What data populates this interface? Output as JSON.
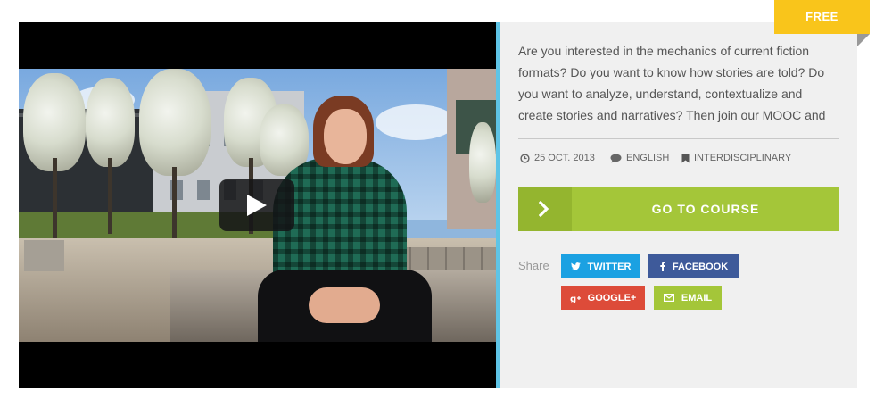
{
  "badge": {
    "label": "FREE"
  },
  "video": {
    "play_label": "Play video"
  },
  "course": {
    "description": "Are you interested in the mechanics of current fiction formats? Do you want to know how stories are told? Do you want to analyze, understand, contextualize and create stories and narratives? Then join our MOOC and",
    "meta": {
      "date": "25 OCT. 2013",
      "language": "ENGLISH",
      "category": "INTERDISCIPLINARY"
    },
    "cta_label": "GO TO COURSE"
  },
  "share": {
    "label": "Share",
    "twitter": "TWITTER",
    "facebook": "FACEBOOK",
    "google": "GOOGLE+",
    "email": "EMAIL"
  },
  "colors": {
    "accent_green": "#a4c639",
    "badge_yellow": "#f9c51b",
    "twitter": "#1ba1e2",
    "facebook": "#3e5a9a",
    "google": "#dd4b39",
    "divider_blue": "#5ec4e6"
  }
}
